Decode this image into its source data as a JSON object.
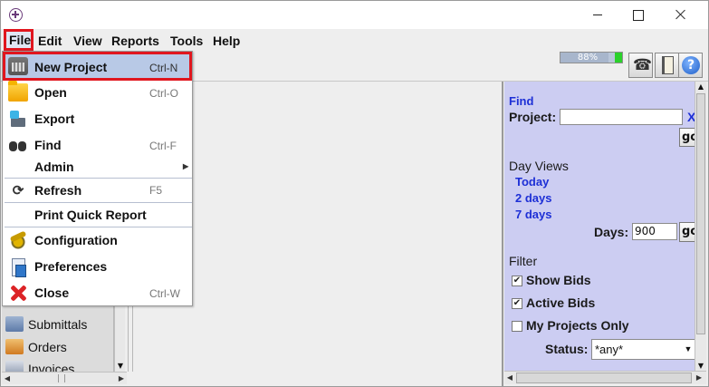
{
  "menubar": {
    "items": [
      "File",
      "Edit",
      "View",
      "Reports",
      "Tools",
      "Help"
    ]
  },
  "toolbar": {
    "memory_label": "88%",
    "memory_percent": 88
  },
  "file_menu": {
    "items": [
      {
        "label": "New Project",
        "shortcut": "Ctrl-N",
        "icon": "building-icon"
      },
      {
        "label": "Open",
        "shortcut": "Ctrl-O",
        "icon": "folder-icon"
      },
      {
        "label": "Export",
        "shortcut": "",
        "icon": "export-icon"
      },
      {
        "label": "Find",
        "shortcut": "Ctrl-F",
        "icon": "binoculars-icon"
      },
      {
        "label": "Admin",
        "shortcut": "",
        "icon": ""
      },
      {
        "label": "Refresh",
        "shortcut": "F5",
        "icon": "refresh-icon"
      },
      {
        "label": "Print Quick Report",
        "shortcut": "",
        "icon": ""
      },
      {
        "label": "Configuration",
        "shortcut": "",
        "icon": "configuration-icon"
      },
      {
        "label": "Preferences",
        "shortcut": "",
        "icon": "preferences-icon"
      },
      {
        "label": "Close",
        "shortcut": "Ctrl-W",
        "icon": "close-icon"
      }
    ]
  },
  "left_panel": {
    "items": [
      "Submittals",
      "Orders",
      "Invoices"
    ]
  },
  "right_panel": {
    "find_heading": "Find",
    "project_label": "Project:",
    "project_value": "",
    "clear_label": "X",
    "go_label": "go",
    "day_views_heading": "Day Views",
    "day_links": [
      "Today",
      "2 days",
      "7 days"
    ],
    "days_label": "Days:",
    "days_value": "900",
    "filter_heading": "Filter",
    "show_bids_label": "Show Bids",
    "show_bids_checked": true,
    "active_bids_label": "Active Bids",
    "active_bids_checked": true,
    "my_projects_label": "My Projects Only",
    "my_projects_checked": false,
    "status_label": "Status:",
    "status_value": "*any*"
  }
}
